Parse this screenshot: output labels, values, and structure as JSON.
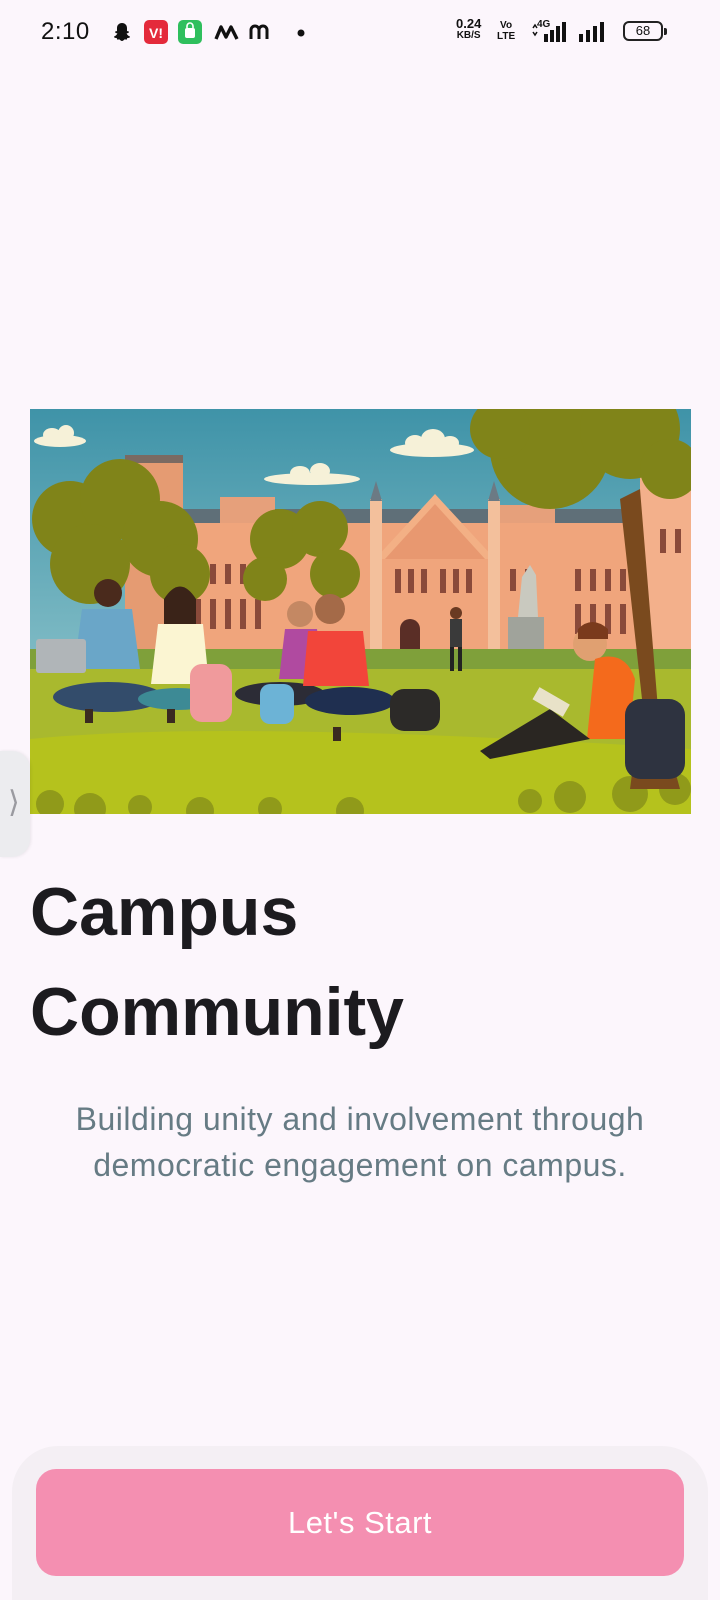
{
  "status_bar": {
    "time": "2:10",
    "net_speed_value": "0.24",
    "net_speed_unit": "KB/S",
    "volte_top": "Vo",
    "volte_bottom": "LTE",
    "network_type": "4G",
    "battery_level": "68",
    "icons": [
      "snapchat-icon",
      "vi-app-icon",
      "store-app-icon",
      "m-app-icon",
      "m-outline-app-icon",
      "dot-icon",
      "signal-icon",
      "signal-icon-2"
    ]
  },
  "hero": {
    "image_name": "campus-students-illustration"
  },
  "main": {
    "title": "Campus Community",
    "subtitle": "Building unity and involvement through democratic engagement on campus."
  },
  "footer": {
    "start_label": "Let's Start"
  },
  "colors": {
    "background": "#fcf6fc",
    "button": "#f48fb1",
    "title": "#1c1b1f",
    "subtitle": "#667b84"
  }
}
